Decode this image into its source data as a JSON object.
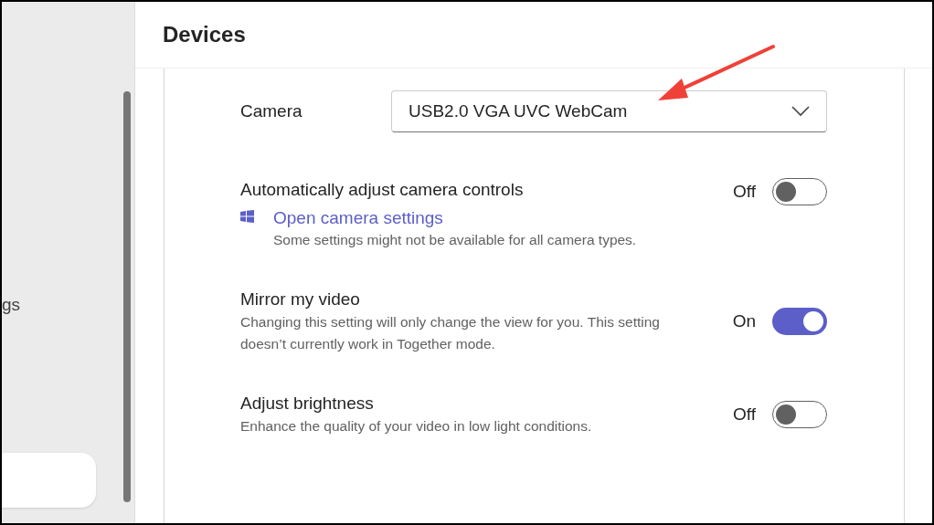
{
  "sidebar": {
    "items": [
      {
        "label": "gs"
      }
    ]
  },
  "header": {
    "title": "Devices"
  },
  "camera": {
    "label": "Camera",
    "value": "USB2.0 VGA UVC WebCam"
  },
  "settings": [
    {
      "kind": "toggle",
      "title": "Automatically adjust camera controls",
      "state_label": "Off",
      "on": false,
      "link": "Open camera settings",
      "description": "Some settings might not be available for all camera types."
    },
    {
      "kind": "toggle",
      "title": "Mirror my video",
      "state_label": "On",
      "on": true,
      "description": "Changing this setting will only change the view for you. This setting doesn’t currently work in Together mode."
    },
    {
      "kind": "toggle",
      "title": "Adjust brightness",
      "state_label": "Off",
      "on": false,
      "description": "Enhance the quality of your video in low light conditions."
    }
  ]
}
